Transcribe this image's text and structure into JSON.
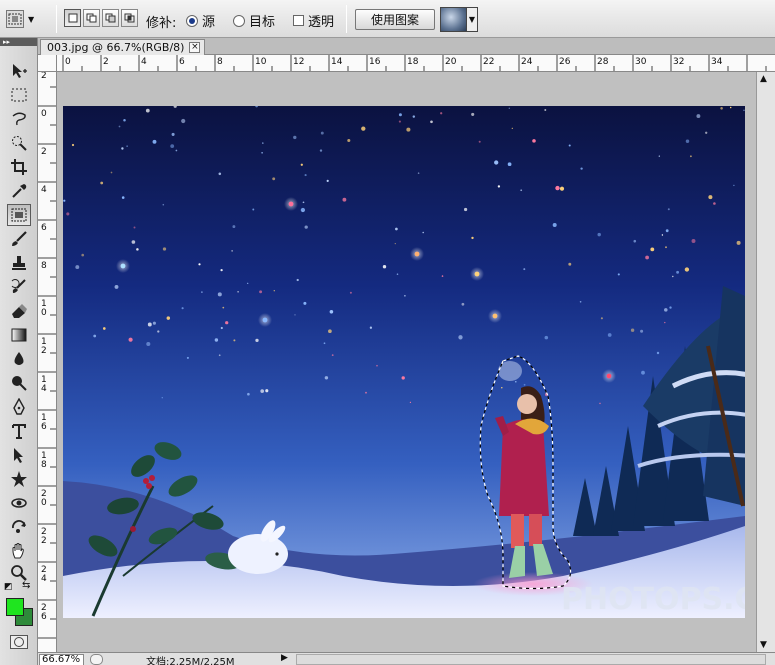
{
  "options_bar": {
    "tool_preset_icon": "patch-tool-icon",
    "patch_label": "修补:",
    "source_label": "源",
    "source_selected": true,
    "destination_label": "目标",
    "destination_selected": false,
    "transparent_label": "透明",
    "transparent_checked": false,
    "use_pattern_label": "使用图案"
  },
  "document": {
    "tab_title": "003.jpg @ 66.7%(RGB/8)",
    "close_symbol": "×"
  },
  "ruler": {
    "top_labels": [
      "0",
      "2",
      "4",
      "6",
      "8",
      "10",
      "12",
      "14",
      "16",
      "18",
      "20",
      "22",
      "24",
      "26",
      "28",
      "30",
      "32",
      "34"
    ],
    "left_labels": [
      "2",
      "0",
      "2",
      "4",
      "6",
      "8",
      "1 0",
      "1 2",
      "1 4",
      "1 6",
      "1 8",
      "2 0",
      "2 2",
      "2 4",
      "2 6"
    ]
  },
  "toolbox": {
    "tools": [
      {
        "name": "move-tool-icon"
      },
      {
        "name": "marquee-tool-icon"
      },
      {
        "name": "lasso-tool-icon"
      },
      {
        "name": "quick-selection-tool-icon"
      },
      {
        "name": "crop-tool-icon"
      },
      {
        "name": "eyedropper-tool-icon"
      },
      {
        "name": "patch-tool-icon",
        "active": true
      },
      {
        "name": "brush-tool-icon"
      },
      {
        "name": "clone-stamp-tool-icon"
      },
      {
        "name": "history-brush-tool-icon"
      },
      {
        "name": "eraser-tool-icon"
      },
      {
        "name": "gradient-tool-icon"
      },
      {
        "name": "blur-tool-icon"
      },
      {
        "name": "dodge-tool-icon"
      },
      {
        "name": "pen-tool-icon"
      },
      {
        "name": "type-tool-icon"
      },
      {
        "name": "path-selection-tool-icon"
      },
      {
        "name": "shape-tool-icon"
      },
      {
        "name": "3d-rotate-tool-icon"
      },
      {
        "name": "3d-orbit-tool-icon"
      },
      {
        "name": "hand-tool-icon"
      },
      {
        "name": "zoom-tool-icon"
      }
    ],
    "foreground_color": "#1fe51f",
    "background_color": "#2e8a3a"
  },
  "status_bar": {
    "zoom": "66.67%",
    "doc_info": "文档:2.25M/2.25M"
  },
  "watermark": "PHOTOPS.COM"
}
